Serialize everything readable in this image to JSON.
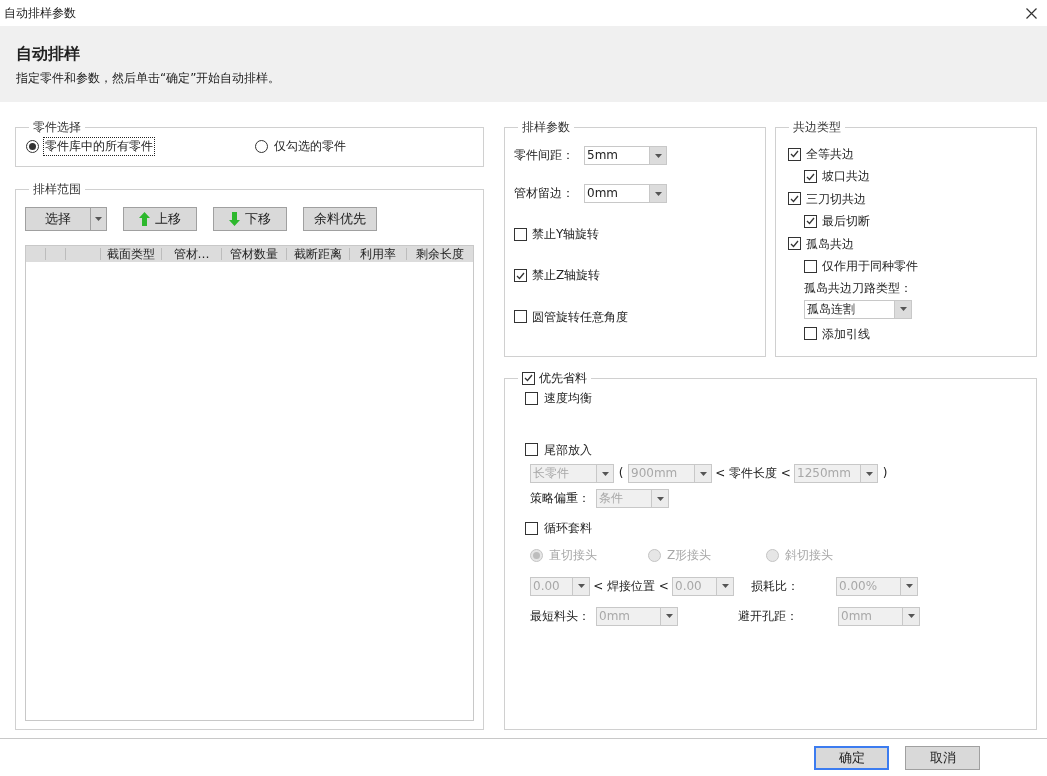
{
  "window": {
    "title": "自动排样参数"
  },
  "header": {
    "title": "自动排样",
    "subtitle": "指定零件和参数，然后单击“确定”开始自动排样。"
  },
  "part_selection": {
    "title": "零件选择",
    "options": [
      {
        "label": "零件库中的所有零件",
        "selected": true,
        "focused": true
      },
      {
        "label": "仅勾选的零件",
        "selected": false,
        "focused": false
      }
    ]
  },
  "nesting_range": {
    "title": "排样范围",
    "buttons": [
      {
        "kind": "split",
        "label": "选择"
      },
      {
        "kind": "up",
        "label": "上移"
      },
      {
        "kind": "down",
        "label": "下移"
      },
      {
        "kind": "plain",
        "label": "余料优先"
      }
    ],
    "table": {
      "columns": [
        "截面类型",
        "管材…",
        "管材数量",
        "截断距离",
        "利用率",
        "剩余长度"
      ]
    }
  },
  "nesting_params": {
    "title": "排样参数",
    "fields": [
      {
        "label": "零件间距：",
        "value": "5mm"
      },
      {
        "label": "管材留边：",
        "value": "0mm"
      }
    ],
    "checks": [
      {
        "label": "禁止Y轴旋转",
        "checked": false
      },
      {
        "label": "禁止Z轴旋转",
        "checked": true
      },
      {
        "label": "圆管旋转任意角度",
        "checked": false
      }
    ]
  },
  "common_edge": {
    "title": "共边类型",
    "items": [
      {
        "kind": "check",
        "label": "全等共边",
        "checked": true,
        "children": [
          {
            "kind": "check",
            "label": "坡口共边",
            "checked": true
          }
        ]
      },
      {
        "kind": "check",
        "label": "三刀切共边",
        "checked": true,
        "children": [
          {
            "kind": "check",
            "label": "最后切断",
            "checked": true
          }
        ]
      },
      {
        "kind": "check",
        "label": "孤岛共边",
        "checked": true,
        "children": [
          {
            "kind": "check",
            "label": "仅作用于同种零件",
            "checked": false
          },
          {
            "kind": "text",
            "text": "孤岛共边刀路类型："
          },
          {
            "kind": "select",
            "value": "孤岛连割",
            "disabled": false
          },
          {
            "kind": "check",
            "label": "添加引线",
            "checked": false
          }
        ]
      }
    ]
  },
  "material_saving": {
    "title": "优先省料",
    "checked": true,
    "rows": [
      {
        "kind": "check",
        "label": "速度均衡",
        "checked": false
      },
      {
        "kind": "check",
        "label": "尾部放入",
        "checked": false
      },
      {
        "kind": "line",
        "items": [
          {
            "kind": "select",
            "value": "长零件",
            "disabled": true
          },
          {
            "kind": "text",
            "text": "("
          },
          {
            "kind": "select",
            "value": "900mm",
            "disabled": true
          },
          {
            "kind": "text",
            "text": "< 零件长度 <"
          },
          {
            "kind": "select",
            "value": "1250mm",
            "disabled": true
          },
          {
            "kind": "text",
            "text": ")"
          }
        ]
      },
      {
        "kind": "line",
        "items": [
          {
            "kind": "text",
            "text": "策略偏重："
          },
          {
            "kind": "select",
            "value": "条件",
            "disabled": true
          }
        ]
      },
      {
        "kind": "check",
        "label": "循环套料",
        "checked": false
      },
      {
        "kind": "radios",
        "items": [
          {
            "label": "直切接头",
            "selected": true,
            "disabled": true
          },
          {
            "label": "Z形接头",
            "selected": false,
            "disabled": true
          },
          {
            "label": "斜切接头",
            "selected": false,
            "disabled": true
          }
        ]
      },
      {
        "kind": "line",
        "items": [
          {
            "kind": "select",
            "value": "0.00",
            "disabled": true
          },
          {
            "kind": "text",
            "text": "< 焊接位置 <"
          },
          {
            "kind": "select",
            "value": "0.00",
            "disabled": true
          },
          {
            "kind": "text",
            "text": "损耗比："
          },
          {
            "kind": "select",
            "value": "0.00%",
            "disabled": true
          }
        ]
      },
      {
        "kind": "line",
        "items": [
          {
            "kind": "text",
            "text": "最短料头："
          },
          {
            "kind": "select",
            "value": "0mm",
            "disabled": true
          },
          {
            "kind": "text",
            "text": "避开孔距："
          },
          {
            "kind": "select",
            "value": "0mm",
            "disabled": true
          }
        ]
      }
    ]
  },
  "footer": {
    "buttons": [
      {
        "label": "确定",
        "focused": true
      },
      {
        "label": "取消",
        "focused": false
      }
    ]
  }
}
